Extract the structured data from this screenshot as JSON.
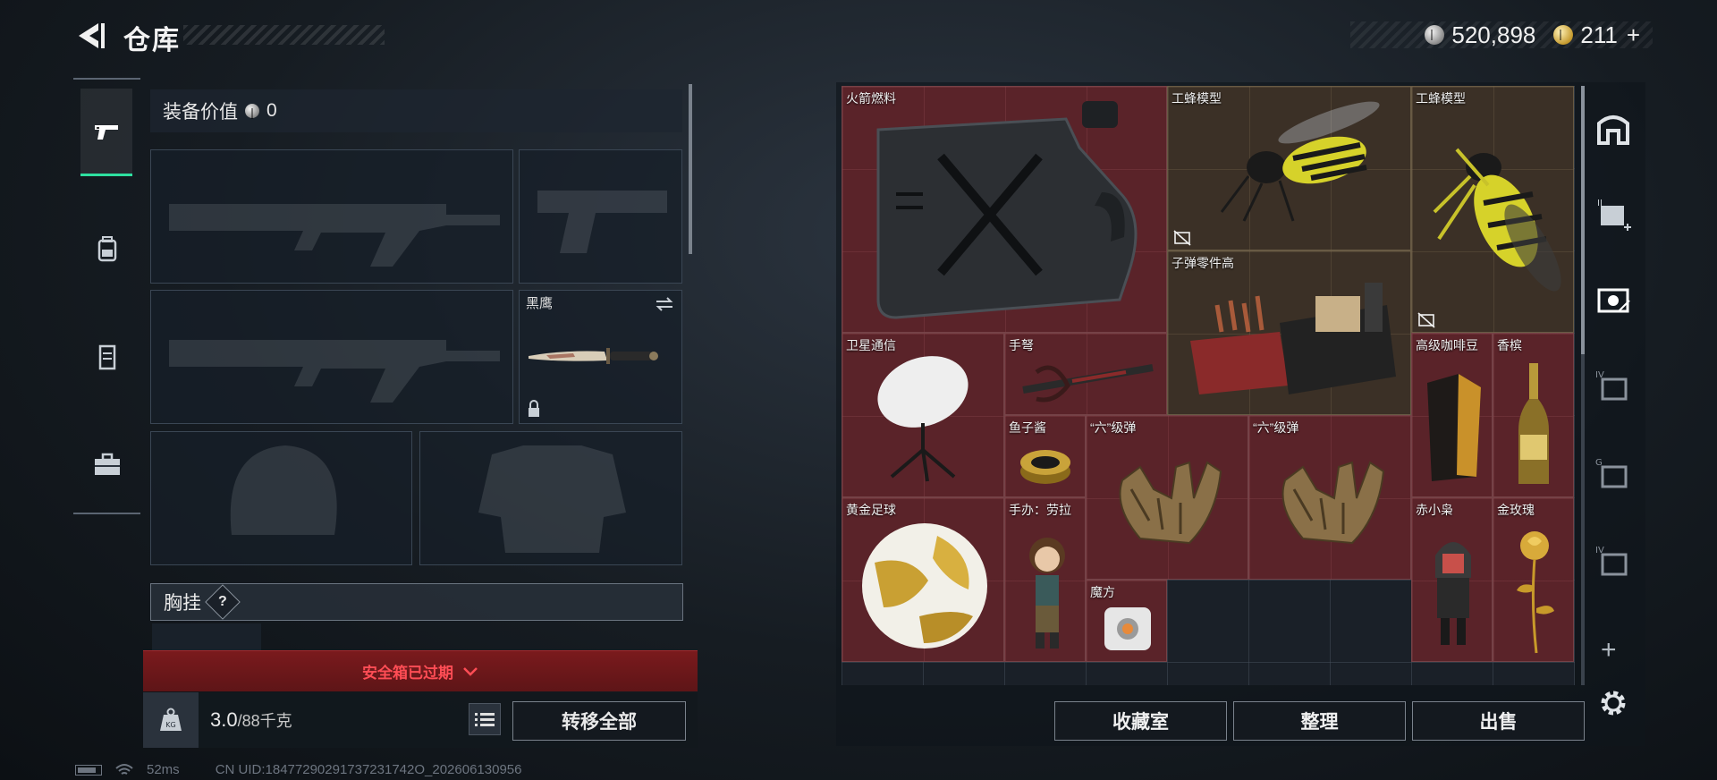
{
  "header": {
    "title": "仓库",
    "currencies": [
      {
        "icon": "silver-coin-icon",
        "value": "520,898"
      },
      {
        "icon": "gold-coin-icon",
        "value": "211"
      }
    ],
    "add_symbol": "+"
  },
  "left_rail": {
    "items": [
      {
        "icon": "pistol-icon",
        "active": true
      },
      {
        "icon": "backpack-icon",
        "active": false
      },
      {
        "icon": "vest-icon",
        "active": false
      },
      {
        "icon": "briefcase-icon",
        "active": false
      }
    ]
  },
  "loadout": {
    "equip_value_label": "装备价值",
    "equip_value": "0",
    "knife_name": "黑鹰",
    "chest_rig_label": "胸挂",
    "help_symbol": "?",
    "safe_box_status": "安全箱已过期",
    "weight_current": "3.0",
    "weight_capacity": "/88千克",
    "weight_icon_text": "KG",
    "transfer_all": "转移全部"
  },
  "stash": {
    "items": [
      {
        "name": "火箭燃料",
        "color": "red",
        "art": "jerrycan-icon"
      },
      {
        "name": "工蜂模型",
        "color": "brown",
        "art": "wasp-model-icon"
      },
      {
        "name": "工蜂模型",
        "color": "brown",
        "art": "wasp-model-icon"
      },
      {
        "name": "子弹零件高",
        "color": "brown",
        "art": "ammo-parts-icon"
      },
      {
        "name": "卫星通信",
        "color": "red",
        "art": "satellite-dish-icon"
      },
      {
        "name": "手弩",
        "color": "red",
        "art": "crossbow-icon"
      },
      {
        "name": "鱼子酱",
        "color": "red",
        "art": "caviar-tin-icon"
      },
      {
        "name": "“六”级弹",
        "color": "red",
        "art": "bullet-hand-icon"
      },
      {
        "name": "“六”级弹",
        "color": "red",
        "art": "bullet-hand-icon"
      },
      {
        "name": "高级咖啡豆",
        "color": "red",
        "art": "coffee-bag-icon"
      },
      {
        "name": "香槟",
        "color": "red",
        "art": "champagne-icon"
      },
      {
        "name": "黄金足球",
        "color": "red",
        "art": "golden-football-icon"
      },
      {
        "name": "手办：劳拉",
        "color": "red",
        "art": "figure-icon"
      },
      {
        "name": "魔方",
        "color": "red",
        "art": "cube-companion-icon"
      },
      {
        "name": "赤小枭",
        "color": "red",
        "art": "red-owl-figure-icon"
      },
      {
        "name": "金玫瑰",
        "color": "red",
        "art": "golden-rose-icon"
      }
    ],
    "buttons": {
      "collection": "收藏室",
      "sort": "整理",
      "sell": "出售"
    },
    "tabs": [
      {
        "icon": "stash-main-icon",
        "roman": ""
      },
      {
        "icon": "stash-ii-icon",
        "roman": "II"
      },
      {
        "icon": "stash-camera-icon",
        "roman": ""
      },
      {
        "icon": "stash-iv-icon",
        "roman": "IV"
      },
      {
        "icon": "stash-g-icon",
        "roman": "G"
      },
      {
        "icon": "stash-iv-b-icon",
        "roman": "IV"
      }
    ]
  },
  "status": {
    "ping": "52ms",
    "uid": "CN UID:18477290291737231742O_202606130956"
  },
  "colors": {
    "accent_green": "#2ee0a0",
    "expired_red": "#ff4d55",
    "item_red_bg": "#5a2329",
    "item_brown_bg": "#3b3026"
  }
}
